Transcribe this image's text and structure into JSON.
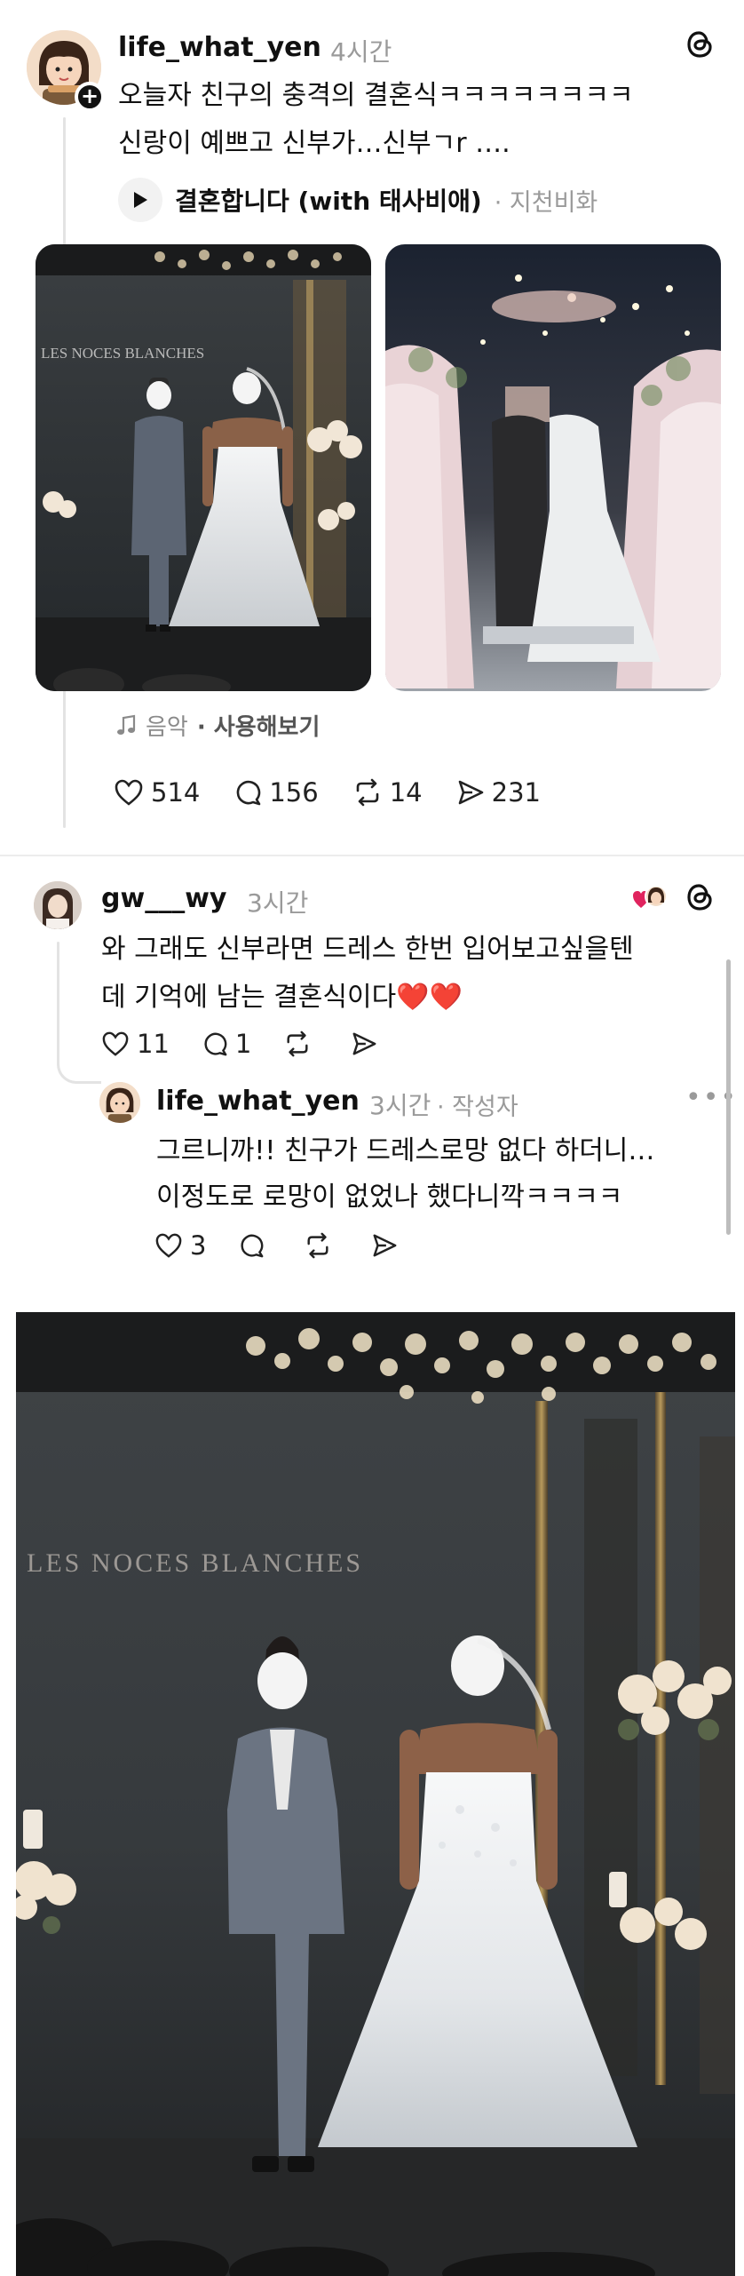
{
  "post": {
    "username": "life_what_yen",
    "time": "4시간",
    "text_line1": "오늘자 친구의 충격의 결혼식ㅋㅋㅋㅋㅋㅋㅋㅋ",
    "text_line2": "신랑이 예쁘고 신부가…신부ㄱr ….",
    "music": {
      "title": "결혼합니다 (with 태사비애)",
      "artist": "· 지천비화"
    },
    "photo1_sign": "LES NOCES BLANCHES",
    "audio": {
      "label": "음악",
      "action": "· 사용해보기"
    },
    "stats": {
      "likes": "514",
      "comments": "156",
      "reposts": "14",
      "shares": "231"
    }
  },
  "reply1": {
    "username": "gw___wy",
    "time": "3시간",
    "text_line1": "와 그래도 신부라면 드레스 한번 입어보고싶을텐",
    "text_line2": "데 기억에 남는 결혼식이다❤️❤️",
    "stats": {
      "likes": "11",
      "comments": "1"
    }
  },
  "reply2": {
    "username": "life_what_yen",
    "time": "3시간",
    "author_tag": "· 작성자",
    "text_line1": "그르니까!! 친구가 드레스로망 없다 하더니…",
    "text_line2": "이정도로 로망이 없었나 했다니깍ㅋㅋㅋㅋ",
    "stats": {
      "likes": "3"
    }
  },
  "large_photo": {
    "sign": "LES NOCES BLANCHES"
  },
  "icons": {
    "threads": "threads-logo-icon",
    "heart": "heart-icon",
    "comment": "comment-icon",
    "repost": "repost-icon",
    "share": "share-icon",
    "play": "play-icon",
    "music": "music-note-icon",
    "more": "more-icon"
  },
  "colors": {
    "text": "#111111",
    "muted": "#9a9a9a",
    "divider": "#ececec",
    "heart_red": "#e0245e"
  }
}
